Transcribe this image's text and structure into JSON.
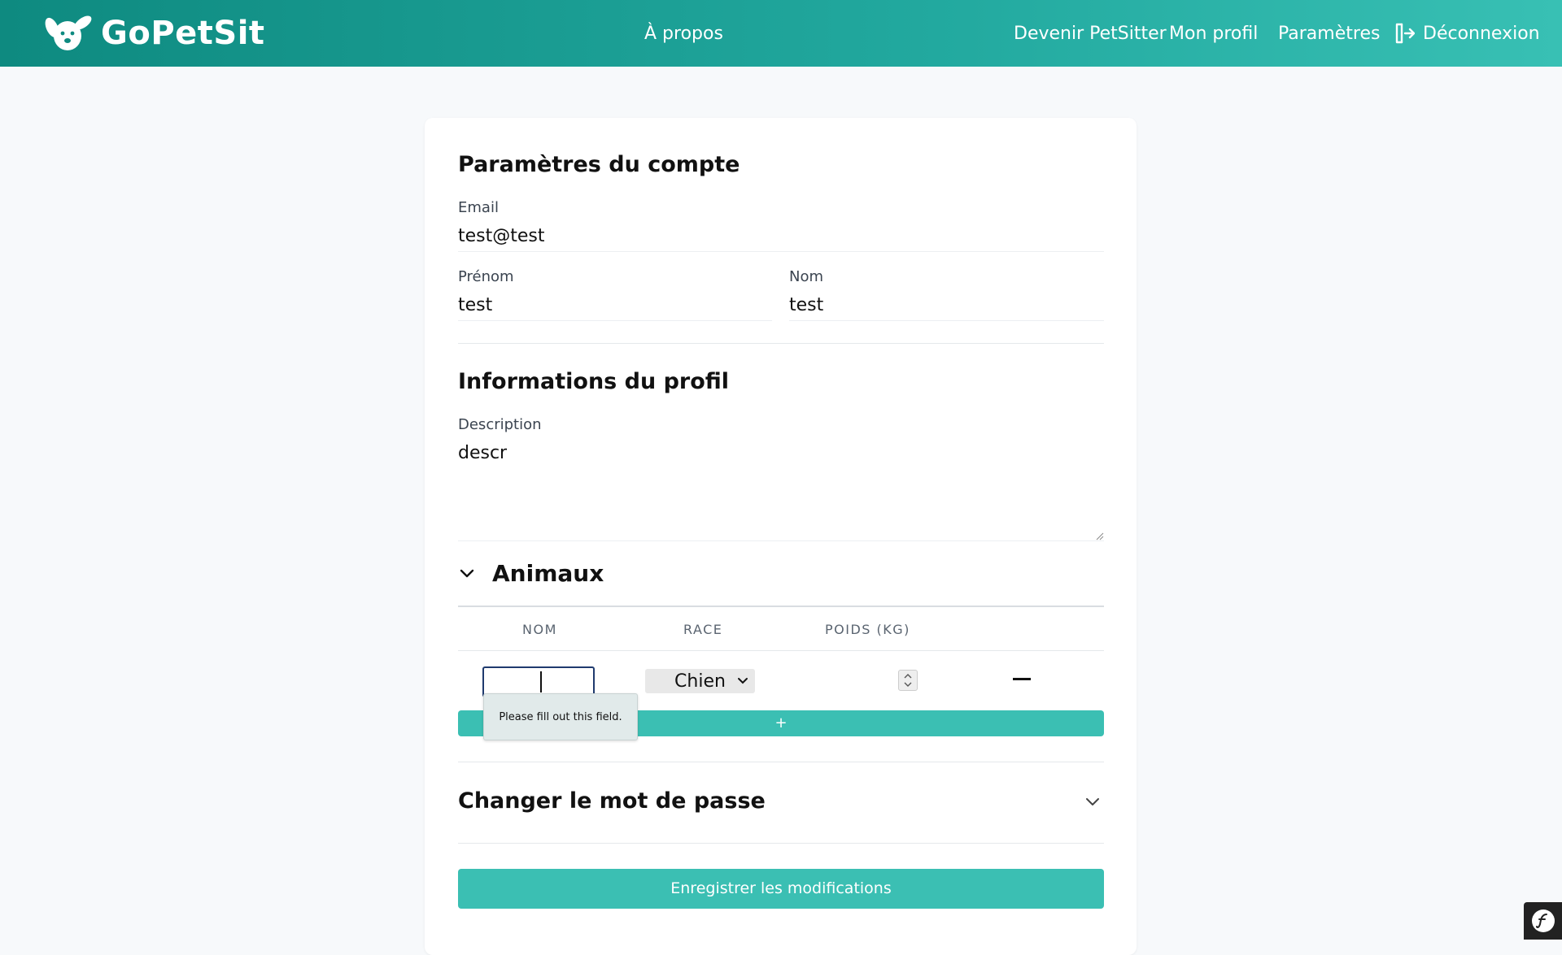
{
  "header": {
    "brand": "GoPetSit",
    "nav": {
      "about": "À propos",
      "become_petsitter": "Devenir PetSitter",
      "my_profile": "Mon profil",
      "settings": "Paramètres",
      "logout": "Déconnexion"
    }
  },
  "account": {
    "title": "Paramètres du compte",
    "email_label": "Email",
    "email_value": "test@test",
    "firstname_label": "Prénom",
    "firstname_value": "test",
    "lastname_label": "Nom",
    "lastname_value": "test"
  },
  "profile": {
    "title": "Informations du profil",
    "description_label": "Description",
    "description_value": "descr"
  },
  "animals": {
    "title": "Animaux",
    "columns": [
      "NOM",
      "RACE",
      "POIDS (KG)"
    ],
    "row": {
      "name_value": "",
      "race_selected": "Chien",
      "weight_value": ""
    },
    "add_label": "+",
    "validation_message": "Please fill out this field."
  },
  "password": {
    "title": "Changer le mot de passe"
  },
  "save_label": "Enregistrer les modifications",
  "colors": {
    "header_start": "#0e8a80",
    "header_end": "#38c0b4",
    "accent": "#3bbfb3"
  },
  "icons": [
    "dog-logo-icon",
    "logout-icon",
    "chevron-down-icon",
    "remove-icon",
    "symfony-icon"
  ]
}
